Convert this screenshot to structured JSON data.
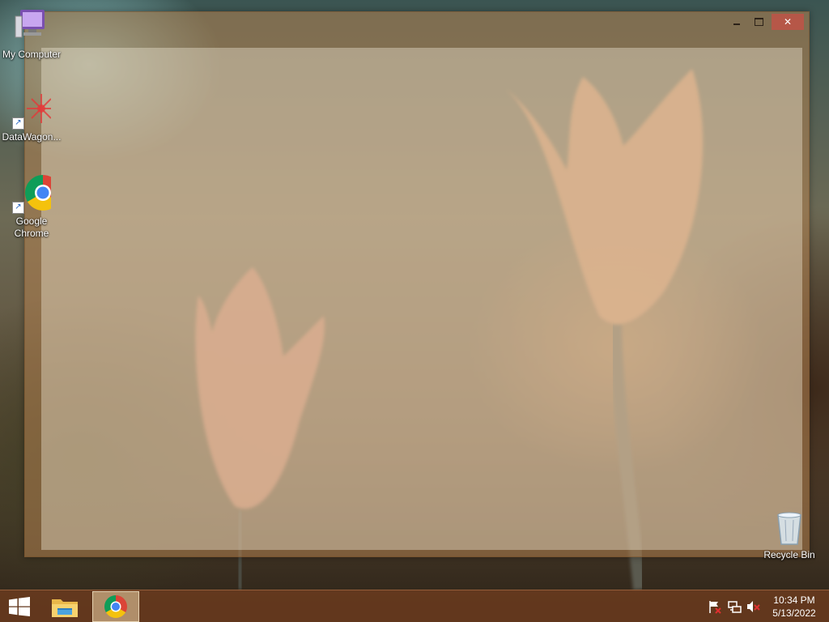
{
  "window": {
    "minimize_glyph": "minimize-icon",
    "maximize_glyph": "maximize-icon",
    "close_label": "✕"
  },
  "desktop_icons": [
    {
      "label": "My Computer",
      "icon": "computer-icon"
    },
    {
      "label": "DataWagon...",
      "icon": "datawagon-icon"
    },
    {
      "label": "Google\nChrome",
      "icon": "chrome-icon"
    },
    {
      "label": "Recycle Bin",
      "icon": "recycle-bin-icon"
    }
  ],
  "taskbar": {
    "start_icon": "windows-logo-icon",
    "pinned": [
      {
        "name": "file-explorer",
        "icon": "folder-icon"
      },
      {
        "name": "google-chrome",
        "icon": "chrome-icon",
        "active": true
      }
    ],
    "tray": [
      {
        "icon": "action-center-flag-icon"
      },
      {
        "icon": "network-icon"
      },
      {
        "icon": "speaker-muted-icon"
      }
    ],
    "clock": {
      "time": "10:34 PM",
      "date": "5/13/2022"
    }
  },
  "colors": {
    "taskbar": "#6e3c1e",
    "window_frame": "#b28250",
    "close_button": "#c85046"
  }
}
